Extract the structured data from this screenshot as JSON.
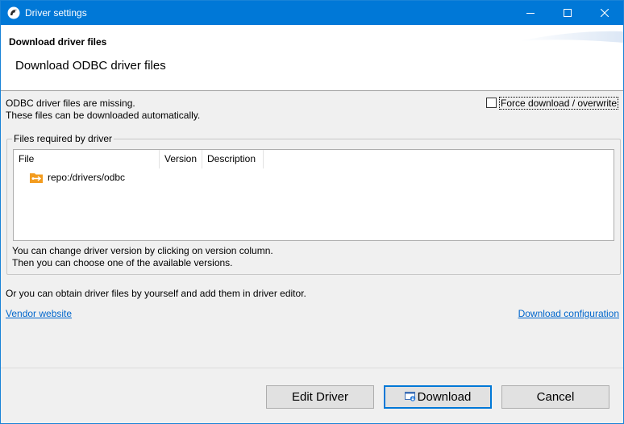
{
  "window": {
    "title": "Driver settings",
    "accent_color": "#0078d7",
    "controls": [
      "minimize-icon",
      "maximize-icon",
      "close-icon"
    ]
  },
  "header": {
    "title": "Download driver files",
    "subtitle": "Download ODBC driver files"
  },
  "message": {
    "line1": "ODBC driver files are missing.",
    "line2": "These files can be downloaded automatically."
  },
  "force_download": {
    "label": "Force download / overwrite",
    "checked": false
  },
  "files_group": {
    "title": "Files required by driver",
    "columns": [
      "File",
      "Version",
      "Description"
    ],
    "rows": [
      {
        "icon": "folder-repo-icon",
        "file": "repo:/drivers/odbc",
        "version": "",
        "description": ""
      }
    ],
    "hint_line1": "You can change driver version by clicking on version column.",
    "hint_line2": "Then you can choose one of the available versions."
  },
  "manual_text": "Or you can obtain driver files by yourself and add them in driver editor.",
  "links": {
    "vendor": "Vendor website",
    "config": "Download configuration",
    "color": "#0066cc"
  },
  "buttons": {
    "edit": "Edit Driver",
    "download": "Download",
    "cancel": "Cancel"
  }
}
